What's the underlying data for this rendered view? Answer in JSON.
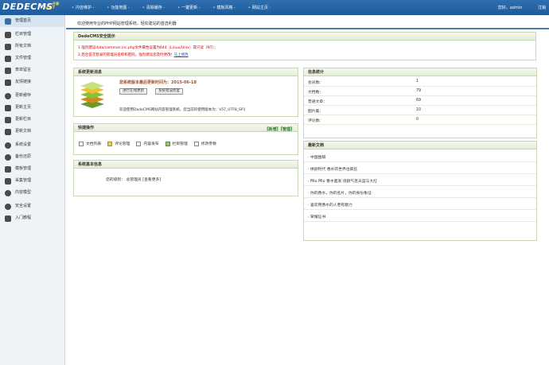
{
  "app": {
    "logo_text": "DEDECMS",
    "version": "v5.7",
    "version_tag": "开源"
  },
  "top_nav": [
    {
      "label": "内容维护"
    },
    {
      "label": "功能地图"
    },
    {
      "label": "清除缓存"
    },
    {
      "label": "一键更新"
    },
    {
      "label": "模板风格"
    },
    {
      "label": "网站主页"
    }
  ],
  "user": {
    "greeting": "您好，admin",
    "logout": "注销"
  },
  "sidebar": {
    "items": [
      {
        "label": "管理首页",
        "icon": "home-icon"
      },
      {
        "label": "栏目管理",
        "icon": "column-icon"
      },
      {
        "label": "所有文档",
        "icon": "documents-icon"
      },
      {
        "label": "文件管理",
        "icon": "file-icon"
      },
      {
        "label": "表单留言",
        "icon": "form-icon"
      },
      {
        "label": "友情链接",
        "icon": "link-icon"
      },
      {
        "label": "更新缓存",
        "icon": "refresh-icon"
      },
      {
        "label": "更新主页",
        "icon": "home-refresh-icon"
      },
      {
        "label": "更新栏目",
        "icon": "column-refresh-icon"
      },
      {
        "label": "更新文档",
        "icon": "doc-refresh-icon"
      },
      {
        "label": "系统设置",
        "icon": "settings-icon"
      },
      {
        "label": "备份还原",
        "icon": "backup-icon"
      },
      {
        "label": "模板管理",
        "icon": "template-icon"
      },
      {
        "label": "采集管理",
        "icon": "collect-icon"
      },
      {
        "label": "内容模型",
        "icon": "model-icon"
      },
      {
        "label": "安全设置",
        "icon": "lock-icon"
      },
      {
        "label": "入门教程",
        "icon": "tutorial-icon"
      }
    ]
  },
  "main": {
    "welcome": "欢迎使用专业的PHP网站管理系统，轻松建站的首选利器"
  },
  "security": {
    "title": "DedeCMS安全提示",
    "line1": "1.强烈建议data/common.inc.php文件属性设置为644（Linux/Unix）或只读（NT）；",
    "line2": "2.后台首次登录的管理员名称和密码，强烈建议您及时更改!",
    "line2_link": "马上修改"
  },
  "update": {
    "title": "系统更新消息",
    "date_text": "您系统版本最后更新时间为：2015-06-18",
    "btn_check": "进行在线更新",
    "btn_sysinfo": "系统错误修复",
    "welcome": "欢迎使用DedeCMS网站内容管理系统，您当前的使用版本为：V57_UTF8_SP1"
  },
  "quick": {
    "title": "快捷操作",
    "links": "【新增】【管理】",
    "items": [
      {
        "label": "文档列表",
        "icon": "doc-list-icon"
      },
      {
        "label": "评论管理",
        "icon": "comment-icon"
      },
      {
        "label": "内容发布",
        "icon": "publish-icon"
      },
      {
        "label": "栏目管理",
        "icon": "column-manage-icon"
      },
      {
        "label": "修改参数",
        "icon": "params-icon"
      }
    ]
  },
  "sysinfo": {
    "title": "系统基本信息",
    "level_label": "您的级别：",
    "level_value": "总管理员",
    "level_more": "[查看更多]"
  },
  "stats": {
    "title": "信息统计",
    "rows": [
      {
        "label": "会员数：",
        "value": "1"
      },
      {
        "label": "文档数：",
        "value": "79"
      },
      {
        "label": "普通文章：",
        "value": "69"
      },
      {
        "label": "图片集：",
        "value": "10"
      },
      {
        "label": "评论数：",
        "value": "0"
      }
    ]
  },
  "latest": {
    "title": "最新文档",
    "items": [
      {
        "title": "· 中国围棋"
      },
      {
        "title": "· 拼颜时代 香水的世界也疯狂"
      },
      {
        "title": "· Miu Miu 香水面发 烧颜气息天蓝与大红"
      },
      {
        "title": "· 你的香水，你的名片，你的身份象征"
      },
      {
        "title": "· 喜欢用香水的人更有魅力"
      },
      {
        "title": "· 荣耀证书"
      }
    ]
  },
  "colors": {
    "topbar": "#1e5a97",
    "panel_border": "#c7d9b2",
    "warning": "#cc0000",
    "accent_green": "#2a7a2a"
  }
}
